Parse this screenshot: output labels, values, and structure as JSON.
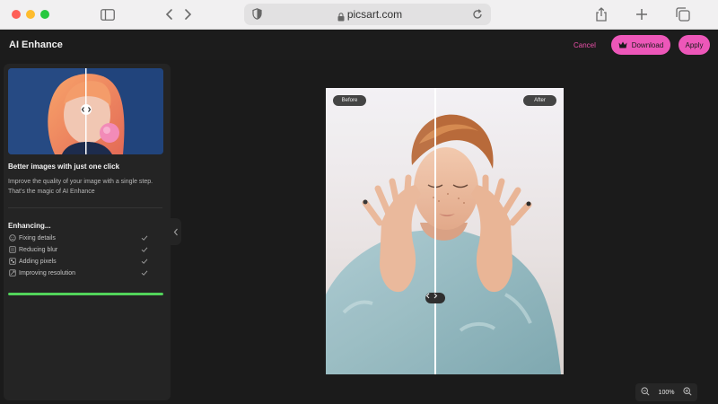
{
  "browser": {
    "url": "picsart.com"
  },
  "header": {
    "title": "AI Enhance",
    "cancel_label": "Cancel",
    "download_label": "Download",
    "apply_label": "Apply"
  },
  "panel": {
    "promo_title": "Better images with just one click",
    "promo_text": "Improve the quality of your image with a single step. That's the magic of AI Enhance",
    "enhancing_title": "Enhancing...",
    "steps": [
      {
        "label": "Fixing details",
        "icon": "sparkle-icon",
        "done": true
      },
      {
        "label": "Reducing blur",
        "icon": "blur-icon",
        "done": true
      },
      {
        "label": "Adding pixels",
        "icon": "pixels-icon",
        "done": true
      },
      {
        "label": "Improving resolution",
        "icon": "resolution-icon",
        "done": true
      }
    ],
    "progress": 1.0
  },
  "canvas": {
    "before_label": "Before",
    "after_label": "After"
  },
  "zoom": {
    "level": "100%"
  },
  "colors": {
    "accent": "#ed57b9",
    "progress": "#52d45a"
  }
}
